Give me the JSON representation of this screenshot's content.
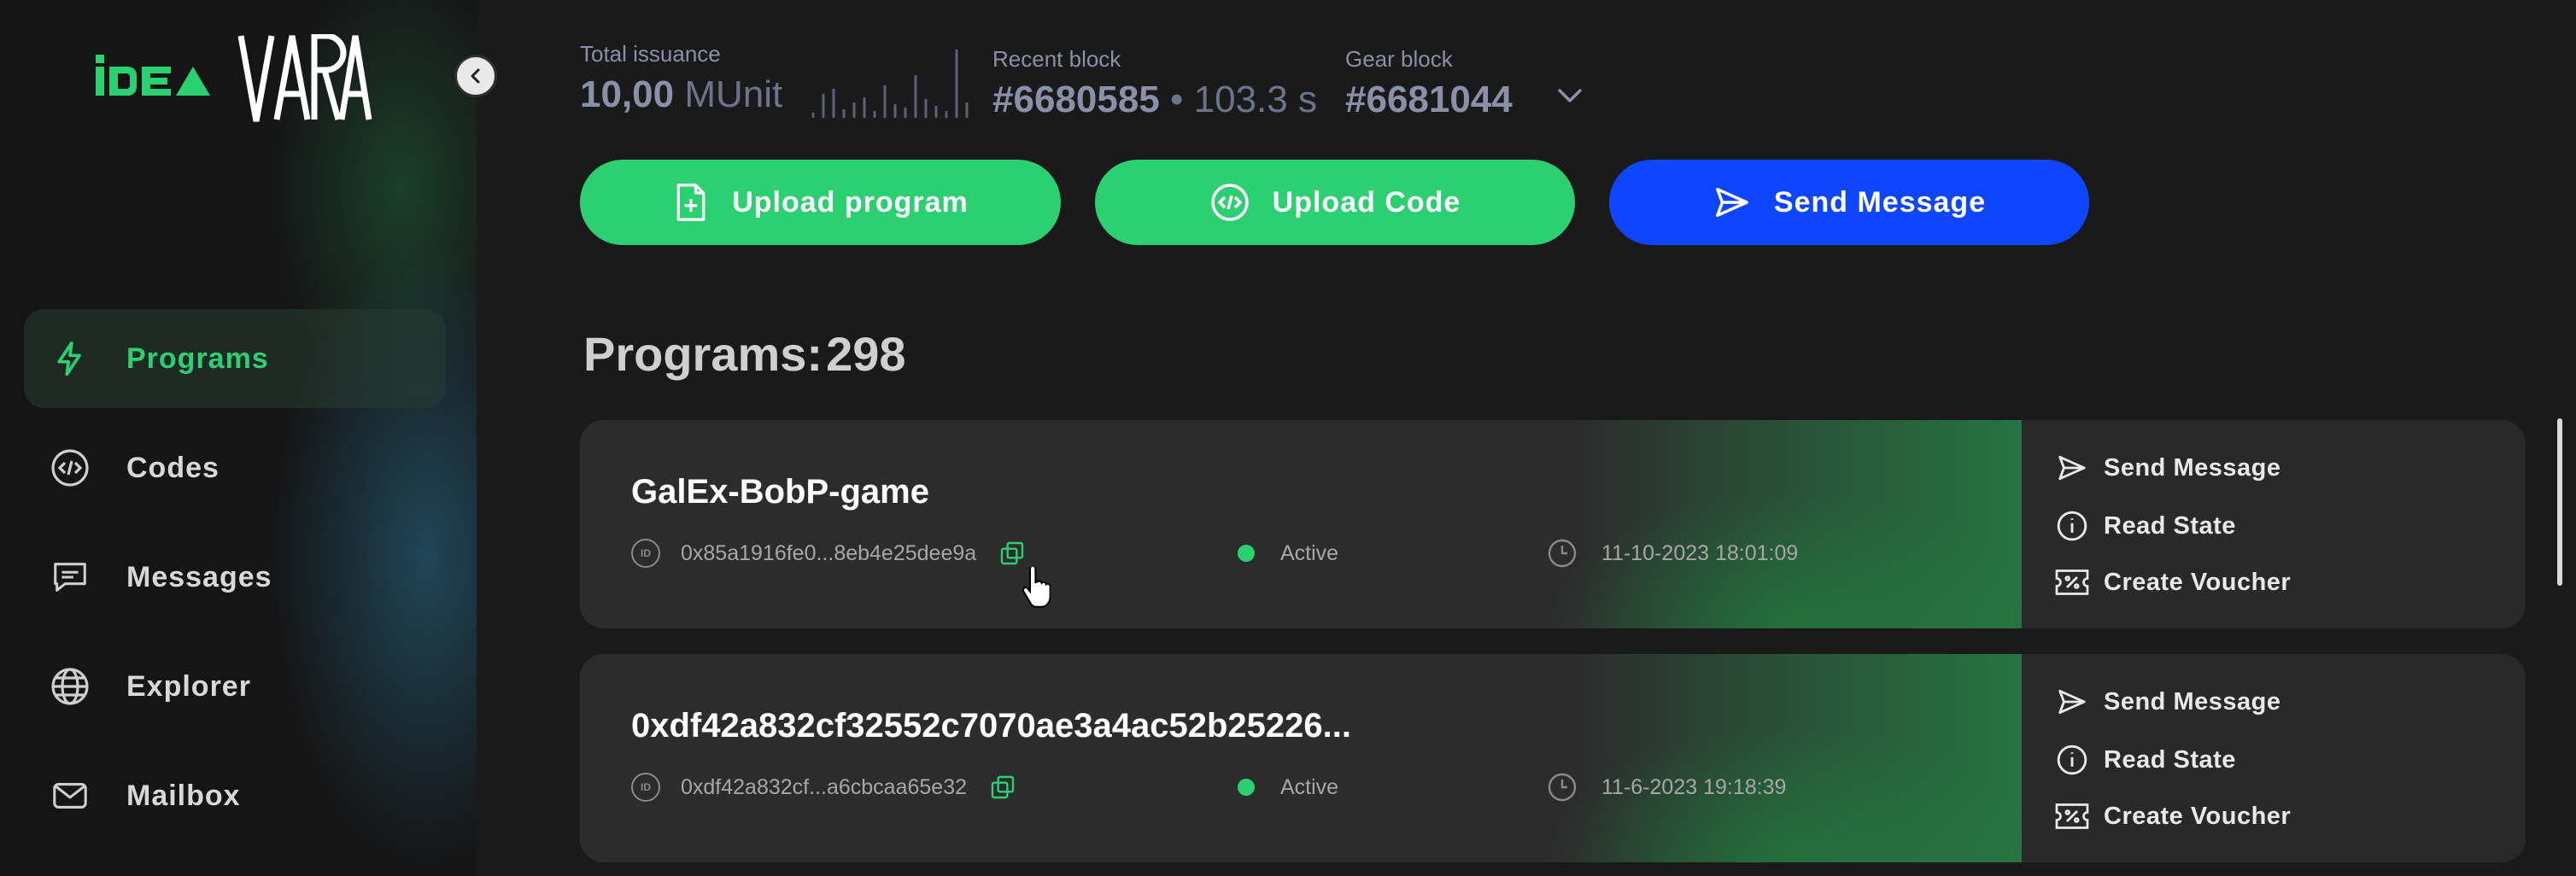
{
  "brand": {
    "logo_left": "iDEA",
    "logo_right": "VARA"
  },
  "sidebar": {
    "items": [
      {
        "label": "Programs",
        "icon": "lightning-icon",
        "active": true
      },
      {
        "label": "Codes",
        "icon": "code-icon"
      },
      {
        "label": "Messages",
        "icon": "message-icon"
      },
      {
        "label": "Explorer",
        "icon": "globe-icon"
      },
      {
        "label": "Mailbox",
        "icon": "mail-icon"
      }
    ]
  },
  "header": {
    "total_issuance": {
      "label": "Total issuance",
      "value": "10,00",
      "unit": "MUnit"
    },
    "recent_block": {
      "label": "Recent block",
      "value": "#6680585",
      "time": "103.3 s"
    },
    "gear_block": {
      "label": "Gear block",
      "value": "#6681044"
    }
  },
  "actions": {
    "upload_program": "Upload program",
    "upload_code": "Upload Code",
    "send_message": "Send Message"
  },
  "programs": {
    "title_label": "Programs:",
    "count": "298",
    "rows": [
      {
        "name": "GalEx-BobP-game",
        "id": "0x85a1916fe0...8eb4e25dee9a",
        "status": "Active",
        "date": "11-10-2023 18:01:09",
        "actions": [
          "Send Message",
          "Read State",
          "Create Voucher"
        ]
      },
      {
        "name": "0xdf42a832cf32552c7070ae3a4ac52b25226...",
        "id": "0xdf42a832cf...a6cbcaa65e32",
        "status": "Active",
        "date": "11-6-2023 19:18:39",
        "actions": [
          "Send Message",
          "Read State",
          "Create Voucher"
        ]
      }
    ]
  },
  "colors": {
    "accent_green": "#2bd071",
    "accent_blue": "#0e46ff",
    "background": "#1a1a1b"
  }
}
